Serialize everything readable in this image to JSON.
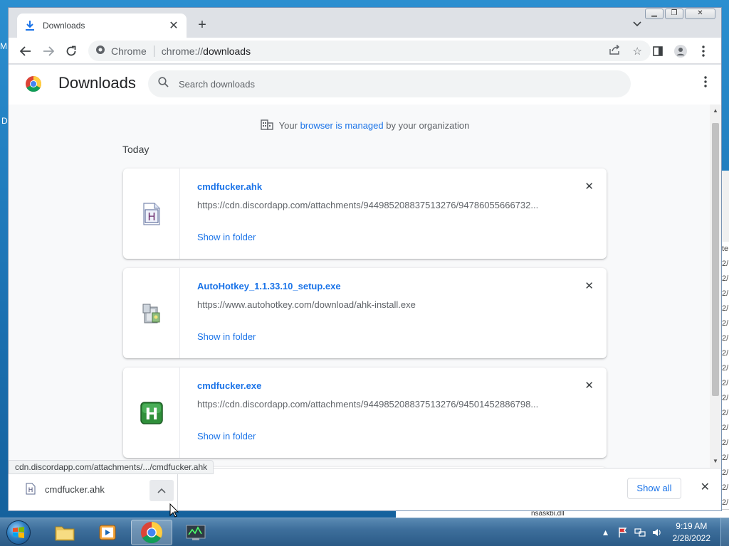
{
  "desktop": {
    "frag_top": "M",
    "frag_mid": "D",
    "bg_list_items": [
      "te",
      "2/",
      "2/",
      "2/",
      "2/",
      "2/",
      "2/",
      "2/",
      "2/",
      "2/",
      "2/",
      "2/",
      "2/",
      "2/",
      "2/",
      "2/",
      "2/",
      "2/"
    ],
    "bg_bottom_text": "nsaskbi.dll"
  },
  "browser": {
    "tab_title": "Downloads",
    "new_tab_label": "+",
    "tab_search_label": "⌄",
    "omnibox_site": "Chrome",
    "omnibox_scheme": "chrome://",
    "omnibox_path": "downloads"
  },
  "page": {
    "title": "Downloads",
    "search_placeholder": "Search downloads",
    "managed_prefix": "Your",
    "managed_link": "browser is managed",
    "managed_suffix": "by your organization",
    "date_label": "Today"
  },
  "downloads": [
    {
      "name": "cmdfucker.ahk",
      "url": "https://cdn.discordapp.com/attachments/944985208837513276/94786055666732...",
      "action": "Show in folder",
      "icon": "ahk-script-icon"
    },
    {
      "name": "AutoHotkey_1.1.33.10_setup.exe",
      "url": "https://www.autohotkey.com/download/ahk-install.exe",
      "action": "Show in folder",
      "icon": "installer-icon"
    },
    {
      "name": "cmdfucker.exe",
      "url": "https://cdn.discordapp.com/attachments/944985208837513276/94501452886798...",
      "action": "Show in folder",
      "icon": "autohotkey-exe-icon"
    }
  ],
  "status_bar": {
    "url": "cdn.discordapp.com/attachments/.../cmdfucker.ahk"
  },
  "download_shelf": {
    "item_name": "cmdfucker.ahk",
    "show_all_label": "Show all"
  },
  "taskbar": {
    "time": "9:19 AM",
    "date": "2/28/2022"
  },
  "colors": {
    "link": "#1a73e8",
    "page_bg": "#f8f9fa",
    "tab_strip": "#dee1e6"
  }
}
